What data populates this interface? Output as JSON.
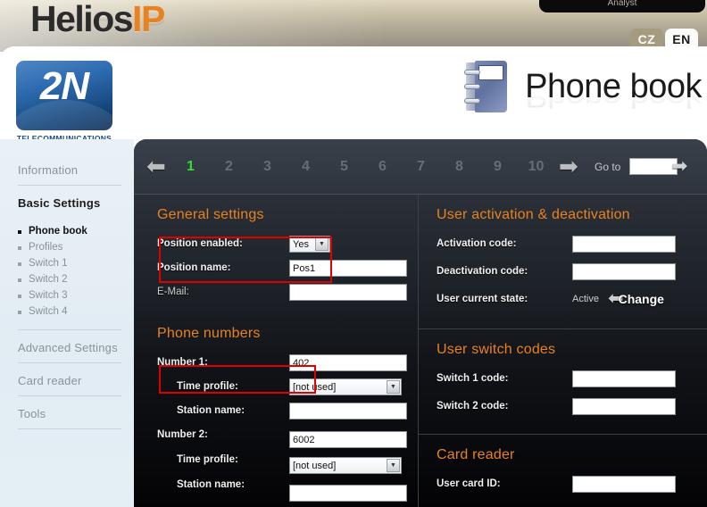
{
  "banner": {
    "product_name_main": "Helios",
    "product_name_suffix": "IP",
    "tab_label": "Analyst",
    "lang_cz": "CZ",
    "lang_en": "EN"
  },
  "brand": {
    "logo_text": "2N",
    "logo_subtext": "TELECOMMUNICATIONS"
  },
  "header": {
    "page_title": "Phone book"
  },
  "sidebar": {
    "groups": [
      {
        "label": "Information",
        "active": false
      },
      {
        "label": "Basic Settings",
        "active": true
      },
      {
        "label": "Advanced Settings",
        "active": false
      },
      {
        "label": "Card reader",
        "active": false
      },
      {
        "label": "Tools",
        "active": false
      }
    ],
    "items": [
      {
        "label": "Phone book",
        "active": true
      },
      {
        "label": "Profiles",
        "active": false
      },
      {
        "label": "Switch 1",
        "active": false
      },
      {
        "label": "Switch 2",
        "active": false
      },
      {
        "label": "Switch 3",
        "active": false
      },
      {
        "label": "Switch 4",
        "active": false
      }
    ]
  },
  "pager": {
    "prev_icon": "left-arrow-icon",
    "next_icon": "right-arrow-icon",
    "pages": [
      "1",
      "2",
      "3",
      "4",
      "5",
      "6",
      "7",
      "8",
      "9",
      "10"
    ],
    "current_page": "1",
    "goto_label": "Go to",
    "goto_value": "",
    "goto_placeholder": ""
  },
  "general_settings": {
    "title": "General settings",
    "position_enabled_label": "Position enabled:",
    "position_enabled_value": "Yes",
    "position_name_label": "Position name:",
    "position_name_value": "Pos1",
    "email_label": "E-Mail:",
    "email_value": ""
  },
  "phone_numbers": {
    "title": "Phone numbers",
    "number1_label": "Number 1:",
    "number1_value": "402",
    "number1_time_profile_label": "Time profile:",
    "number1_time_profile_value": "[not used]",
    "number1_station_label": "Station name:",
    "number1_station_value": "",
    "number2_label": "Number 2:",
    "number2_value": "6002",
    "number2_time_profile_label": "Time profile:",
    "number2_time_profile_value": "[not used]",
    "number2_station_label": "Station name:",
    "number2_station_value": ""
  },
  "user_activation": {
    "title": "User activation & deactivation",
    "activation_code_label": "Activation code:",
    "activation_code_value": "",
    "deactivation_code_label": "Deactivation code:",
    "deactivation_code_value": "",
    "state_label": "User current state:",
    "state_value": "Active",
    "change_button_label": "Change"
  },
  "user_switch_codes": {
    "title": "User switch codes",
    "switch1_label": "Switch 1 code:",
    "switch1_value": "",
    "switch2_label": "Switch 2 code:",
    "switch2_value": ""
  },
  "card_reader": {
    "title": "Card reader",
    "user_card_id_label": "User card ID:",
    "user_card_id_value": ""
  },
  "colors": {
    "accent_orange": "#e8821e",
    "current_page_green": "#2fe02f",
    "annotation_red": "#e00000",
    "brand_blue": "#17497f",
    "sidebar_bg": "#e3edf4",
    "panel_dark": "#0d0d10"
  }
}
